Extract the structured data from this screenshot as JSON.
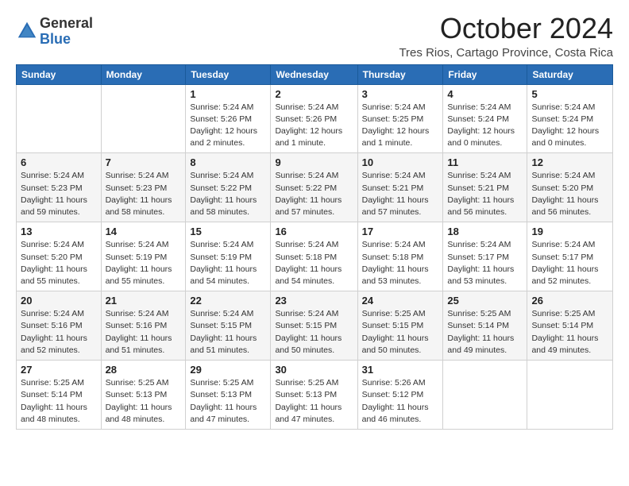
{
  "logo": {
    "general": "General",
    "blue": "Blue"
  },
  "title": "October 2024",
  "subtitle": "Tres Rios, Cartago Province, Costa Rica",
  "calendar": {
    "headers": [
      "Sunday",
      "Monday",
      "Tuesday",
      "Wednesday",
      "Thursday",
      "Friday",
      "Saturday"
    ],
    "rows": [
      [
        {
          "day": "",
          "info": ""
        },
        {
          "day": "",
          "info": ""
        },
        {
          "day": "1",
          "info": "Sunrise: 5:24 AM\nSunset: 5:26 PM\nDaylight: 12 hours and 2 minutes."
        },
        {
          "day": "2",
          "info": "Sunrise: 5:24 AM\nSunset: 5:26 PM\nDaylight: 12 hours and 1 minute."
        },
        {
          "day": "3",
          "info": "Sunrise: 5:24 AM\nSunset: 5:25 PM\nDaylight: 12 hours and 1 minute."
        },
        {
          "day": "4",
          "info": "Sunrise: 5:24 AM\nSunset: 5:24 PM\nDaylight: 12 hours and 0 minutes."
        },
        {
          "day": "5",
          "info": "Sunrise: 5:24 AM\nSunset: 5:24 PM\nDaylight: 12 hours and 0 minutes."
        }
      ],
      [
        {
          "day": "6",
          "info": "Sunrise: 5:24 AM\nSunset: 5:23 PM\nDaylight: 11 hours and 59 minutes."
        },
        {
          "day": "7",
          "info": "Sunrise: 5:24 AM\nSunset: 5:23 PM\nDaylight: 11 hours and 58 minutes."
        },
        {
          "day": "8",
          "info": "Sunrise: 5:24 AM\nSunset: 5:22 PM\nDaylight: 11 hours and 58 minutes."
        },
        {
          "day": "9",
          "info": "Sunrise: 5:24 AM\nSunset: 5:22 PM\nDaylight: 11 hours and 57 minutes."
        },
        {
          "day": "10",
          "info": "Sunrise: 5:24 AM\nSunset: 5:21 PM\nDaylight: 11 hours and 57 minutes."
        },
        {
          "day": "11",
          "info": "Sunrise: 5:24 AM\nSunset: 5:21 PM\nDaylight: 11 hours and 56 minutes."
        },
        {
          "day": "12",
          "info": "Sunrise: 5:24 AM\nSunset: 5:20 PM\nDaylight: 11 hours and 56 minutes."
        }
      ],
      [
        {
          "day": "13",
          "info": "Sunrise: 5:24 AM\nSunset: 5:20 PM\nDaylight: 11 hours and 55 minutes."
        },
        {
          "day": "14",
          "info": "Sunrise: 5:24 AM\nSunset: 5:19 PM\nDaylight: 11 hours and 55 minutes."
        },
        {
          "day": "15",
          "info": "Sunrise: 5:24 AM\nSunset: 5:19 PM\nDaylight: 11 hours and 54 minutes."
        },
        {
          "day": "16",
          "info": "Sunrise: 5:24 AM\nSunset: 5:18 PM\nDaylight: 11 hours and 54 minutes."
        },
        {
          "day": "17",
          "info": "Sunrise: 5:24 AM\nSunset: 5:18 PM\nDaylight: 11 hours and 53 minutes."
        },
        {
          "day": "18",
          "info": "Sunrise: 5:24 AM\nSunset: 5:17 PM\nDaylight: 11 hours and 53 minutes."
        },
        {
          "day": "19",
          "info": "Sunrise: 5:24 AM\nSunset: 5:17 PM\nDaylight: 11 hours and 52 minutes."
        }
      ],
      [
        {
          "day": "20",
          "info": "Sunrise: 5:24 AM\nSunset: 5:16 PM\nDaylight: 11 hours and 52 minutes."
        },
        {
          "day": "21",
          "info": "Sunrise: 5:24 AM\nSunset: 5:16 PM\nDaylight: 11 hours and 51 minutes."
        },
        {
          "day": "22",
          "info": "Sunrise: 5:24 AM\nSunset: 5:15 PM\nDaylight: 11 hours and 51 minutes."
        },
        {
          "day": "23",
          "info": "Sunrise: 5:24 AM\nSunset: 5:15 PM\nDaylight: 11 hours and 50 minutes."
        },
        {
          "day": "24",
          "info": "Sunrise: 5:25 AM\nSunset: 5:15 PM\nDaylight: 11 hours and 50 minutes."
        },
        {
          "day": "25",
          "info": "Sunrise: 5:25 AM\nSunset: 5:14 PM\nDaylight: 11 hours and 49 minutes."
        },
        {
          "day": "26",
          "info": "Sunrise: 5:25 AM\nSunset: 5:14 PM\nDaylight: 11 hours and 49 minutes."
        }
      ],
      [
        {
          "day": "27",
          "info": "Sunrise: 5:25 AM\nSunset: 5:14 PM\nDaylight: 11 hours and 48 minutes."
        },
        {
          "day": "28",
          "info": "Sunrise: 5:25 AM\nSunset: 5:13 PM\nDaylight: 11 hours and 48 minutes."
        },
        {
          "day": "29",
          "info": "Sunrise: 5:25 AM\nSunset: 5:13 PM\nDaylight: 11 hours and 47 minutes."
        },
        {
          "day": "30",
          "info": "Sunrise: 5:25 AM\nSunset: 5:13 PM\nDaylight: 11 hours and 47 minutes."
        },
        {
          "day": "31",
          "info": "Sunrise: 5:26 AM\nSunset: 5:12 PM\nDaylight: 11 hours and 46 minutes."
        },
        {
          "day": "",
          "info": ""
        },
        {
          "day": "",
          "info": ""
        }
      ]
    ]
  }
}
